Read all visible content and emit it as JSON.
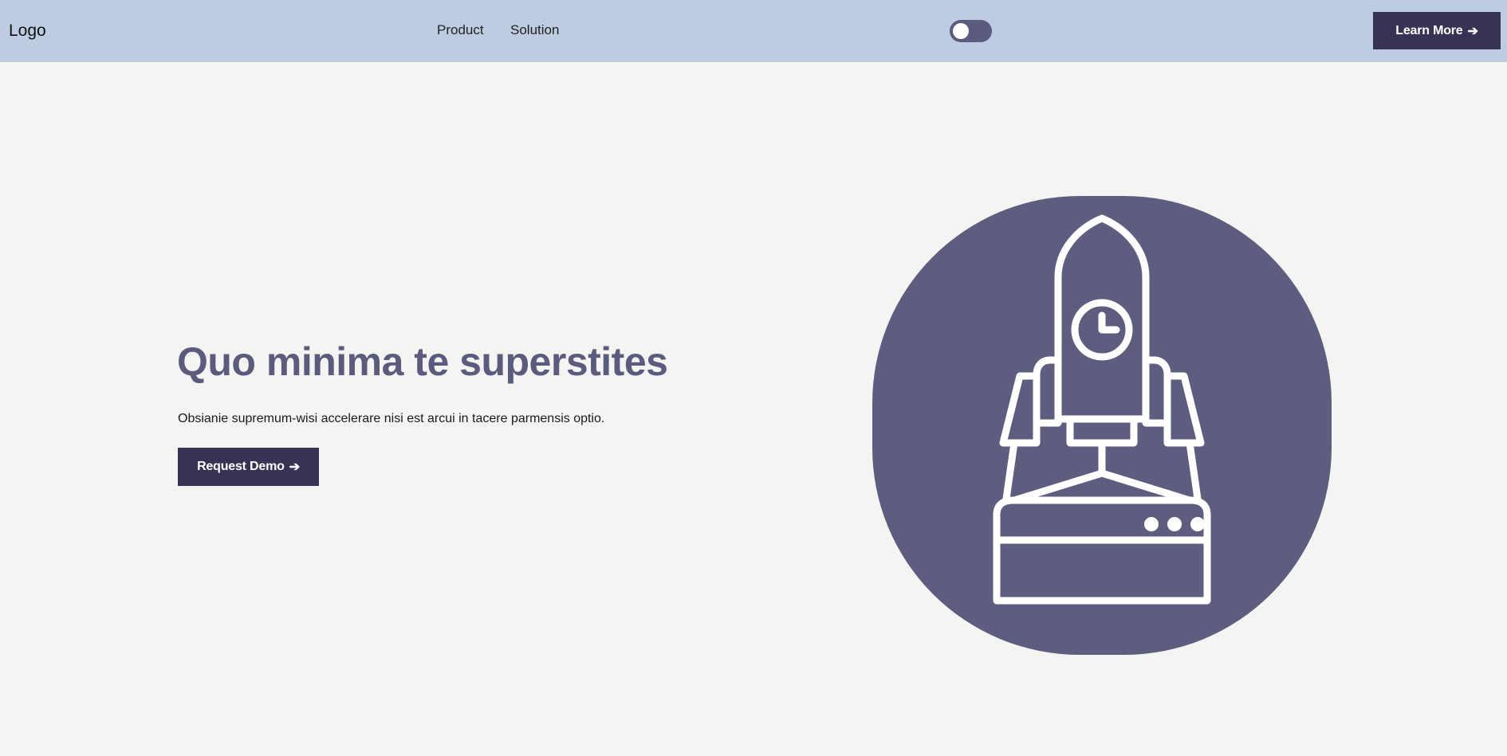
{
  "header": {
    "logo": "Logo",
    "nav": [
      "Product",
      "Solution"
    ],
    "theme_toggle": {
      "state": "off",
      "icon": "toggle-switch"
    },
    "cta_label": "Learn More",
    "cta_arrow": "➔"
  },
  "hero": {
    "title": "Quo minima te superstites",
    "subtitle": "Obsianie supremum-wisi accelerare nisi est arcui in tacere parmensis optio.",
    "cta_label": "Request Demo",
    "cta_arrow": "➔",
    "illustration_icon": "rocket-launch-icon"
  },
  "colors": {
    "header_bg": "#bdcce0",
    "page_bg": "#f4f4f3",
    "primary_button": "#383254",
    "accent": "#5b5b7e",
    "illustration_bg": "#5d5d80"
  }
}
